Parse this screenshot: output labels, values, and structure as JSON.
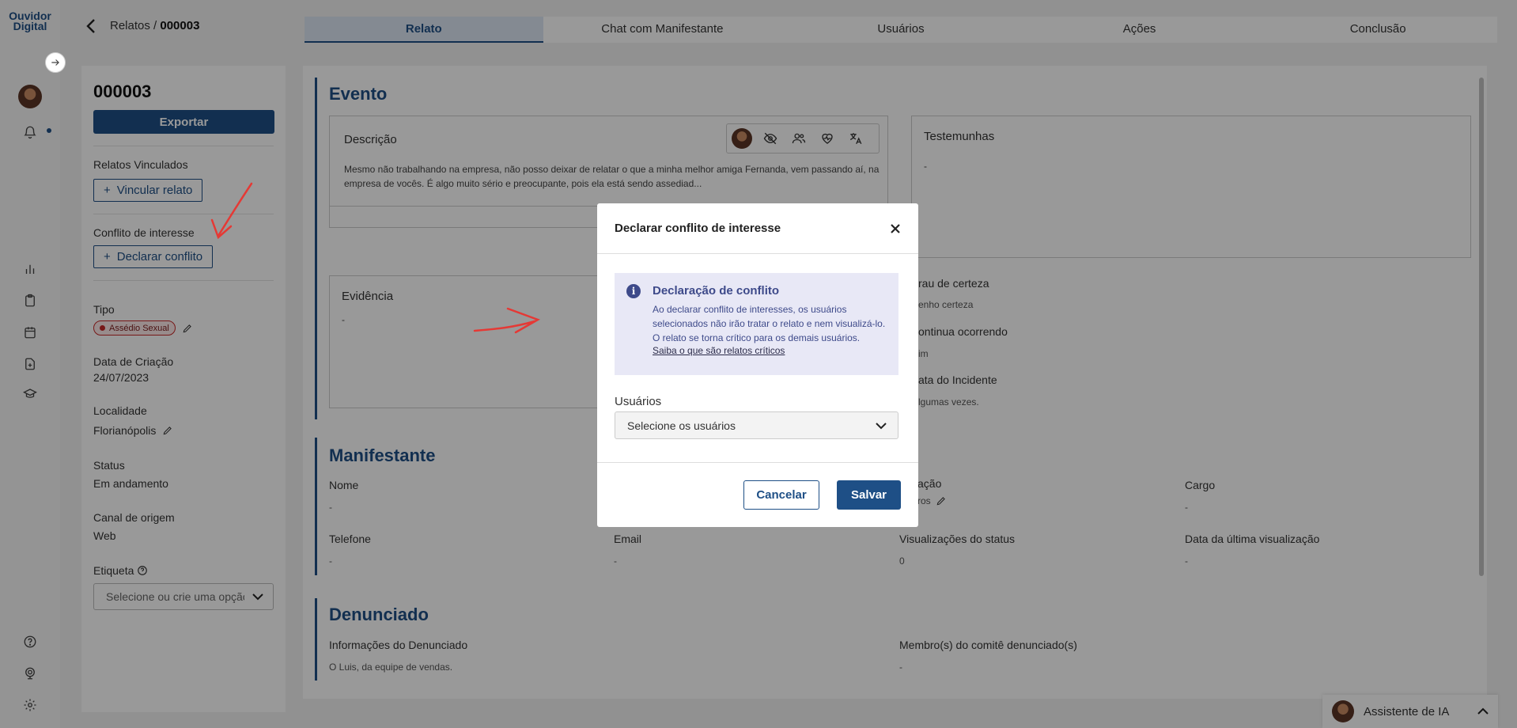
{
  "app": {
    "logo_text": "Ouvidor Digital"
  },
  "breadcrumb": {
    "parent": "Relatos",
    "separator": "/",
    "current": "000003"
  },
  "tabs": [
    {
      "label": "Relato",
      "active": true
    },
    {
      "label": "Chat com Manifestante",
      "active": false
    },
    {
      "label": "Usuários",
      "active": false
    },
    {
      "label": "Ações",
      "active": false
    },
    {
      "label": "Conclusão",
      "active": false
    }
  ],
  "side": {
    "id": "000003",
    "export_label": "Exportar",
    "linked_title": "Relatos Vinculados",
    "link_button": "Vincular relato",
    "conflict_title": "Conflito de interesse",
    "conflict_button": "Declarar conflito",
    "type_label": "Tipo",
    "type_badge": "Assédio Sexual",
    "created_label": "Data de Criação",
    "created_value": "24/07/2023",
    "location_label": "Localidade",
    "location_value": "Florianópolis",
    "status_label": "Status",
    "status_value": "Em andamento",
    "channel_label": "Canal de origem",
    "channel_value": "Web",
    "tag_label": "Etiqueta",
    "tag_placeholder": "Selecione ou crie uma opção"
  },
  "evento": {
    "title": "Evento",
    "description_label": "Descrição",
    "description_text": "Mesmo não trabalhando na empresa, não posso deixar de relatar o que a minha melhor amiga Fernanda, vem passando aí, na empresa de vocês. É algo muito sério e preocupante, pois ela está sendo assediad...",
    "witnesses_label": "Testemunhas",
    "witnesses_value": "-",
    "evidence_label": "Evidência",
    "evidence_value": "-",
    "certainty_label": "rau de certeza",
    "certainty_value": "enho certeza",
    "ongoing_label": "ontinua ocorrendo",
    "ongoing_value": "im",
    "incident_date_label": "ata do Incidente",
    "incident_date_value": "lgumas vezes."
  },
  "manifestante": {
    "title": "Manifestante",
    "name_label": "Nome",
    "name_value": "-",
    "relation_label": "ação",
    "relation_value": "ros",
    "role_label": "Cargo",
    "role_value": "-",
    "phone_label": "Telefone",
    "phone_value": "-",
    "email_label": "Email",
    "email_value": "-",
    "views_label": "Visualizações do status",
    "views_value": "0",
    "last_view_label": "Data da última visualização",
    "last_view_value": "-"
  },
  "denunciado": {
    "title": "Denunciado",
    "info_label": "Informações do Denunciado",
    "info_value": "O Luis, da equipe de vendas.",
    "committee_label": "Membro(s) do comitê denunciado(s)",
    "committee_value": "-"
  },
  "modal": {
    "title": "Declarar conflito de interesse",
    "info_icon": "i",
    "info_title": "Declaração de conflito",
    "info_text": "Ao declarar conflito de interesses, os usuários selecionados não irão tratar o relato e nem visualizá-lo. O relato se torna crítico para os demais usuários.",
    "info_link": "Saiba o que são relatos críticos",
    "users_label": "Usuários",
    "users_placeholder": "Selecione os usuários",
    "cancel_label": "Cancelar",
    "save_label": "Salvar"
  },
  "assistant": {
    "label": "Assistente de IA"
  },
  "colors": {
    "primary": "#1e4f86",
    "overlay": "rgba(0,0,0,0.4)",
    "badge_red": "#c62828",
    "info_bg": "#e8e8f6",
    "annotation": "#e53935"
  },
  "icons": [
    "arrow-right-icon",
    "bell-icon",
    "bar-chart-icon",
    "clipboard-icon",
    "calendar-icon",
    "file-plus-icon",
    "graduation-cap-icon",
    "help-icon",
    "webcam-icon",
    "gear-icon",
    "chevron-left-icon",
    "plus-icon",
    "pencil-icon",
    "question-circle-icon",
    "chevron-down-icon",
    "eye-off-icon",
    "users-icon",
    "heart-pulse-icon",
    "translate-icon",
    "close-icon",
    "info-icon",
    "chevron-up-icon"
  ]
}
